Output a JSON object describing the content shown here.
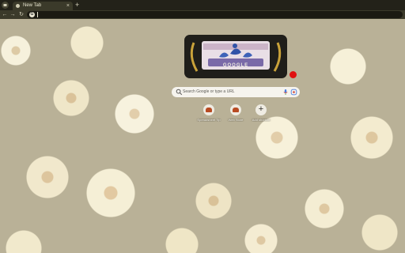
{
  "tabs": [
    {
      "title": "New Tab",
      "close_glyph": "×"
    }
  ],
  "new_tab_glyph": "+",
  "toolbar": {
    "back_glyph": "←",
    "forward_glyph": "→",
    "reload_glyph": "↻",
    "omnibox_badge": "G"
  },
  "doodle": {
    "text": "GOOGLE"
  },
  "search": {
    "placeholder": "Search Google or type a URL"
  },
  "shortcuts": [
    {
      "label": "Spreadsheet Tip",
      "icon": "pizza-icon"
    },
    {
      "label": "Web Store",
      "icon": "pizza-icon"
    },
    {
      "label": "Add shortcut",
      "icon": "plus-icon",
      "glyph": "+"
    }
  ],
  "colors": {
    "tab_bg": "#3b3a2a",
    "frame_bg": "#232219",
    "accent_red": "#e01010",
    "doodle_bg": "#1f1e1a"
  }
}
